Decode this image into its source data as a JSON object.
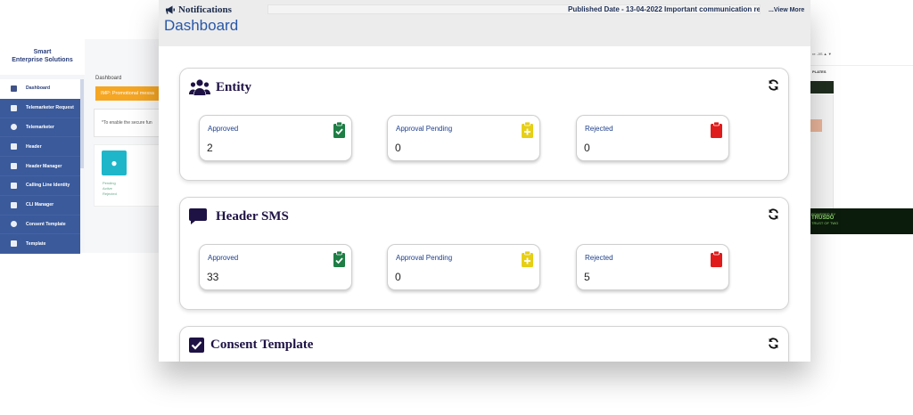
{
  "left_app": {
    "brand": "Smart\nEnterprise Solutions",
    "breadcrumb": "Dashboard",
    "alert": "IMP: Promotional messa",
    "info": "*To enable the secure fun",
    "sidebar": [
      {
        "label": "Dashboard",
        "active": true
      },
      {
        "label": "Telemarketer Request"
      },
      {
        "label": "Telemarketer"
      },
      {
        "label": "Header"
      },
      {
        "label": "Header Manager"
      },
      {
        "label": "Calling Line Identity"
      },
      {
        "label": "CLI Manager"
      },
      {
        "label": "Consent Template"
      },
      {
        "label": "Template"
      }
    ],
    "card_status": [
      "Pending",
      "Active",
      "Rejected"
    ]
  },
  "right_app": {
    "topbar": "re  .JIS  ▲ ▼",
    "label": "PLATES",
    "footer_line1": "POWERED BY",
    "footer_line2": "TRUSDO",
    "footer_line3": "TRUST OF TWO"
  },
  "header": {
    "notifications_label": "Notifications",
    "ticker_text": "Published Date - 13-04-2022 Important communication reg",
    "view_more": "...View More",
    "page_title": "Dashboard"
  },
  "sections": [
    {
      "title": "Entity",
      "icon": "users-icon",
      "cards": [
        {
          "label": "Approved",
          "value": "2",
          "icon": "clipboard-check-icon",
          "color": "#1e7e45"
        },
        {
          "label": "Approval Pending",
          "value": "0",
          "icon": "clipboard-plus-icon",
          "color": "#e6cf16"
        },
        {
          "label": "Rejected",
          "value": "0",
          "icon": "clipboard-icon",
          "color": "#e01b1b"
        }
      ]
    },
    {
      "title": "Header SMS",
      "icon": "message-icon",
      "cards": [
        {
          "label": "Approved",
          "value": "33",
          "icon": "clipboard-check-icon",
          "color": "#1e7e45"
        },
        {
          "label": "Approval Pending",
          "value": "0",
          "icon": "clipboard-plus-icon",
          "color": "#e6cf16"
        },
        {
          "label": "Rejected",
          "value": "5",
          "icon": "clipboard-icon",
          "color": "#e01b1b"
        }
      ]
    },
    {
      "title": "Consent Template",
      "icon": "checkbox-icon",
      "cards": []
    }
  ],
  "colors": {
    "title_blue": "#2857a8",
    "section_title": "#1e1245",
    "sidebar": "#3a5a9c"
  }
}
